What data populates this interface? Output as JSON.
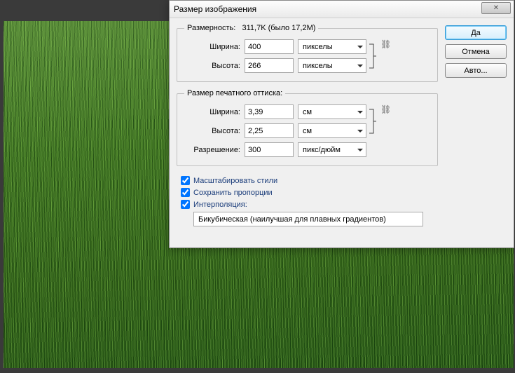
{
  "dialog": {
    "title": "Размер изображения",
    "close_symbol": "✕"
  },
  "pixel_dimensions": {
    "legend_prefix": "Размерность:",
    "size_info": "311,7K (было 17,2M)",
    "width_label": "Ширина:",
    "width_value": "400",
    "width_unit": "пикселы",
    "height_label": "Высота:",
    "height_value": "266",
    "height_unit": "пикселы"
  },
  "document_size": {
    "legend": "Размер печатного оттиска:",
    "width_label": "Ширина:",
    "width_value": "3,39",
    "width_unit": "см",
    "height_label": "Высота:",
    "height_value": "2,25",
    "height_unit": "см",
    "resolution_label": "Разрешение:",
    "resolution_value": "300",
    "resolution_unit": "пикс/дюйм"
  },
  "checkboxes": {
    "scale_styles": "Масштабировать стили",
    "constrain": "Сохранить пропорции",
    "resample": "Интерполяция:"
  },
  "interpolation": {
    "selected": "Бикубическая (наилучшая для плавных градиентов)"
  },
  "buttons": {
    "ok": "Да",
    "cancel": "Отмена",
    "auto": "Авто..."
  },
  "link_glyph": "⛓"
}
